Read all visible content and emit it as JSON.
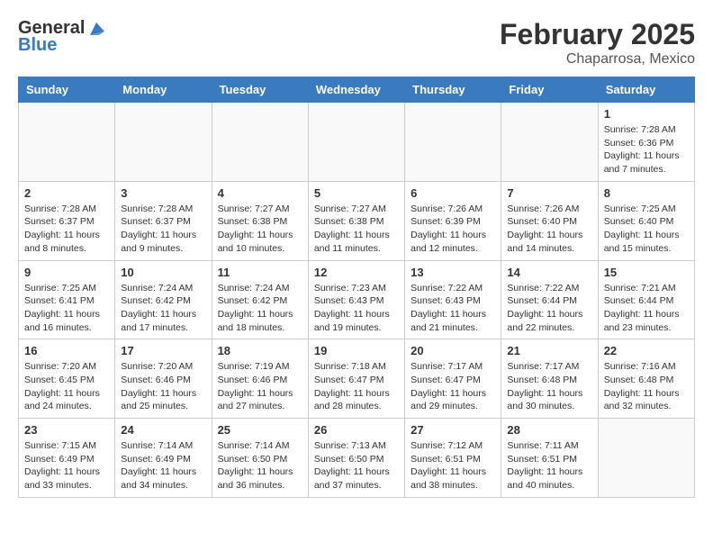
{
  "header": {
    "logo_general": "General",
    "logo_blue": "Blue",
    "month_year": "February 2025",
    "location": "Chaparrosa, Mexico"
  },
  "days_of_week": [
    "Sunday",
    "Monday",
    "Tuesday",
    "Wednesday",
    "Thursday",
    "Friday",
    "Saturday"
  ],
  "weeks": [
    [
      {
        "day": "",
        "info": ""
      },
      {
        "day": "",
        "info": ""
      },
      {
        "day": "",
        "info": ""
      },
      {
        "day": "",
        "info": ""
      },
      {
        "day": "",
        "info": ""
      },
      {
        "day": "",
        "info": ""
      },
      {
        "day": "1",
        "info": "Sunrise: 7:28 AM\nSunset: 6:36 PM\nDaylight: 11 hours and 7 minutes."
      }
    ],
    [
      {
        "day": "2",
        "info": "Sunrise: 7:28 AM\nSunset: 6:37 PM\nDaylight: 11 hours and 8 minutes."
      },
      {
        "day": "3",
        "info": "Sunrise: 7:28 AM\nSunset: 6:37 PM\nDaylight: 11 hours and 9 minutes."
      },
      {
        "day": "4",
        "info": "Sunrise: 7:27 AM\nSunset: 6:38 PM\nDaylight: 11 hours and 10 minutes."
      },
      {
        "day": "5",
        "info": "Sunrise: 7:27 AM\nSunset: 6:38 PM\nDaylight: 11 hours and 11 minutes."
      },
      {
        "day": "6",
        "info": "Sunrise: 7:26 AM\nSunset: 6:39 PM\nDaylight: 11 hours and 12 minutes."
      },
      {
        "day": "7",
        "info": "Sunrise: 7:26 AM\nSunset: 6:40 PM\nDaylight: 11 hours and 14 minutes."
      },
      {
        "day": "8",
        "info": "Sunrise: 7:25 AM\nSunset: 6:40 PM\nDaylight: 11 hours and 15 minutes."
      }
    ],
    [
      {
        "day": "9",
        "info": "Sunrise: 7:25 AM\nSunset: 6:41 PM\nDaylight: 11 hours and 16 minutes."
      },
      {
        "day": "10",
        "info": "Sunrise: 7:24 AM\nSunset: 6:42 PM\nDaylight: 11 hours and 17 minutes."
      },
      {
        "day": "11",
        "info": "Sunrise: 7:24 AM\nSunset: 6:42 PM\nDaylight: 11 hours and 18 minutes."
      },
      {
        "day": "12",
        "info": "Sunrise: 7:23 AM\nSunset: 6:43 PM\nDaylight: 11 hours and 19 minutes."
      },
      {
        "day": "13",
        "info": "Sunrise: 7:22 AM\nSunset: 6:43 PM\nDaylight: 11 hours and 21 minutes."
      },
      {
        "day": "14",
        "info": "Sunrise: 7:22 AM\nSunset: 6:44 PM\nDaylight: 11 hours and 22 minutes."
      },
      {
        "day": "15",
        "info": "Sunrise: 7:21 AM\nSunset: 6:44 PM\nDaylight: 11 hours and 23 minutes."
      }
    ],
    [
      {
        "day": "16",
        "info": "Sunrise: 7:20 AM\nSunset: 6:45 PM\nDaylight: 11 hours and 24 minutes."
      },
      {
        "day": "17",
        "info": "Sunrise: 7:20 AM\nSunset: 6:46 PM\nDaylight: 11 hours and 25 minutes."
      },
      {
        "day": "18",
        "info": "Sunrise: 7:19 AM\nSunset: 6:46 PM\nDaylight: 11 hours and 27 minutes."
      },
      {
        "day": "19",
        "info": "Sunrise: 7:18 AM\nSunset: 6:47 PM\nDaylight: 11 hours and 28 minutes."
      },
      {
        "day": "20",
        "info": "Sunrise: 7:17 AM\nSunset: 6:47 PM\nDaylight: 11 hours and 29 minutes."
      },
      {
        "day": "21",
        "info": "Sunrise: 7:17 AM\nSunset: 6:48 PM\nDaylight: 11 hours and 30 minutes."
      },
      {
        "day": "22",
        "info": "Sunrise: 7:16 AM\nSunset: 6:48 PM\nDaylight: 11 hours and 32 minutes."
      }
    ],
    [
      {
        "day": "23",
        "info": "Sunrise: 7:15 AM\nSunset: 6:49 PM\nDaylight: 11 hours and 33 minutes."
      },
      {
        "day": "24",
        "info": "Sunrise: 7:14 AM\nSunset: 6:49 PM\nDaylight: 11 hours and 34 minutes."
      },
      {
        "day": "25",
        "info": "Sunrise: 7:14 AM\nSunset: 6:50 PM\nDaylight: 11 hours and 36 minutes."
      },
      {
        "day": "26",
        "info": "Sunrise: 7:13 AM\nSunset: 6:50 PM\nDaylight: 11 hours and 37 minutes."
      },
      {
        "day": "27",
        "info": "Sunrise: 7:12 AM\nSunset: 6:51 PM\nDaylight: 11 hours and 38 minutes."
      },
      {
        "day": "28",
        "info": "Sunrise: 7:11 AM\nSunset: 6:51 PM\nDaylight: 11 hours and 40 minutes."
      },
      {
        "day": "",
        "info": ""
      }
    ]
  ]
}
